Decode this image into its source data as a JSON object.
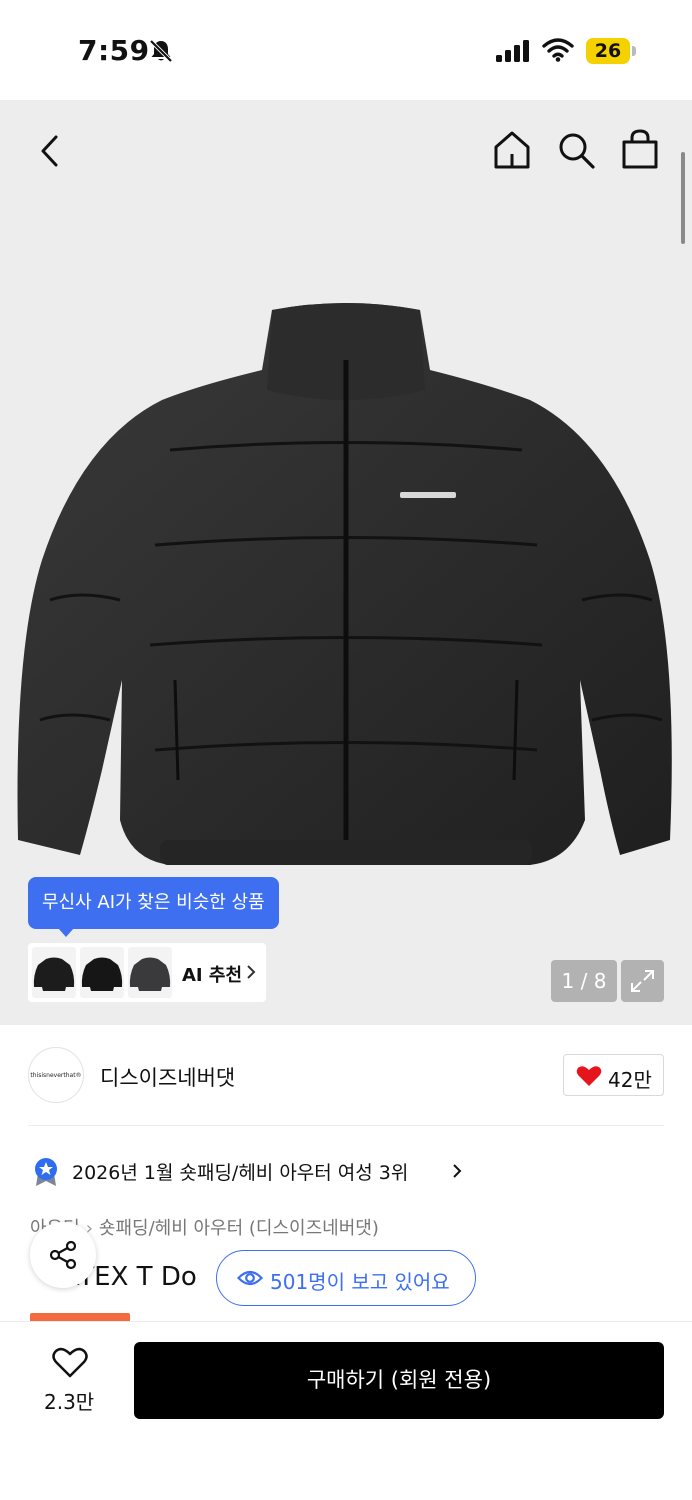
{
  "status_bar": {
    "time": "7:59",
    "battery": "26",
    "icons": [
      "bell-slash-icon",
      "signal-icon",
      "wifi-icon",
      "battery-icon"
    ],
    "battery_color": "#f5d100"
  },
  "nav": {
    "icons": [
      "back-chevron-icon",
      "home-icon",
      "search-icon",
      "shopping-bag-icon"
    ]
  },
  "hero": {
    "image": "black-puffer-jacket",
    "pager": "1 / 8",
    "ai_tooltip": "무신사 AI가 찾은 비슷한 상품",
    "ai_recommend_label": "AI 추천",
    "tooltip_color": "#3d6ff0"
  },
  "brand": {
    "name": "디스이즈네버댓",
    "logo_text": "thisisneverthat®",
    "likes": "42만"
  },
  "ranking": {
    "text": "2026년 1월 숏패딩/헤비 아우터 여성 3위"
  },
  "breadcrumb": {
    "first": "아우터",
    "second": "숏패딩/헤비 아우터 (디스이즈네버댓)"
  },
  "product": {
    "title_visible": "PERTEX T Do"
  },
  "viewers": {
    "text": "501명이 보고 있어요"
  },
  "bottom": {
    "wish_count": "2.3만",
    "buy_label": "구매하기 (회원 전용)"
  }
}
